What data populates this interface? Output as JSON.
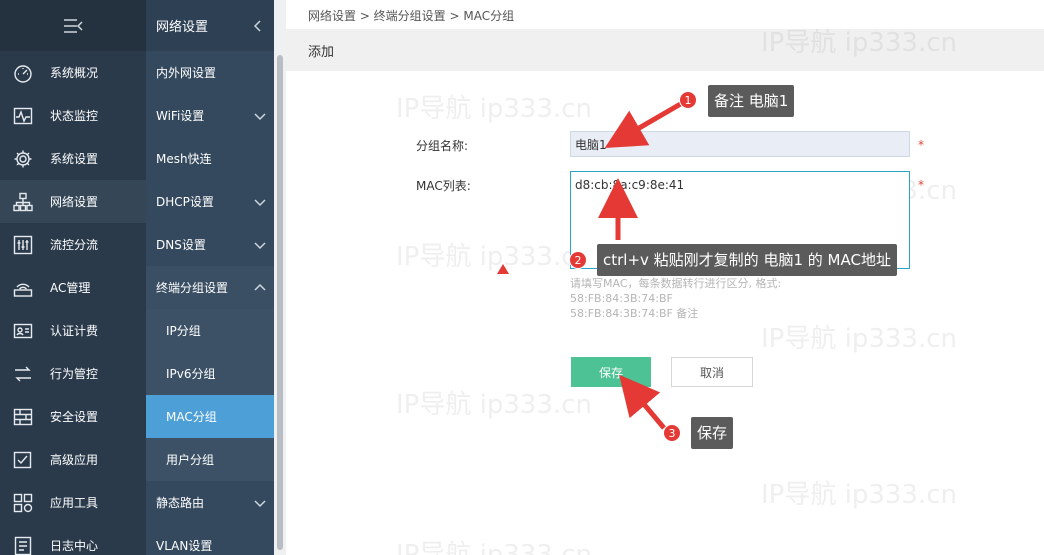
{
  "sidebar": {
    "items": [
      {
        "label": "系统概况",
        "icon": "dashboard-icon"
      },
      {
        "label": "状态监控",
        "icon": "monitor-icon"
      },
      {
        "label": "系统设置",
        "icon": "gear-icon"
      },
      {
        "label": "网络设置",
        "icon": "network-icon"
      },
      {
        "label": "流控分流",
        "icon": "sliders-icon"
      },
      {
        "label": "AC管理",
        "icon": "wifi-ap-icon"
      },
      {
        "label": "认证计费",
        "icon": "id-card-icon"
      },
      {
        "label": "行为管控",
        "icon": "arrows-icon"
      },
      {
        "label": "安全设置",
        "icon": "firewall-icon"
      },
      {
        "label": "高级应用",
        "icon": "checkbox-icon"
      },
      {
        "label": "应用工具",
        "icon": "apps-icon"
      },
      {
        "label": "日志中心",
        "icon": "log-icon"
      }
    ]
  },
  "subbar": {
    "title": "网络设置",
    "items": [
      {
        "label": "内外网设置"
      },
      {
        "label": "WiFi设置"
      },
      {
        "label": "Mesh快连"
      },
      {
        "label": "DHCP设置"
      },
      {
        "label": "DNS设置"
      },
      {
        "label": "终端分组设置"
      },
      {
        "label": "IP分组"
      },
      {
        "label": "IPv6分组"
      },
      {
        "label": "MAC分组"
      },
      {
        "label": "用户分组"
      },
      {
        "label": "静态路由"
      },
      {
        "label": "VLAN设置"
      }
    ]
  },
  "main": {
    "breadcrumb": "网络设置 > 终端分组设置 > MAC分组",
    "page_title": "添加",
    "form": {
      "name_label": "分组名称:",
      "name_value": "电脑1",
      "mac_label": "MAC列表:",
      "mac_value": "d8:cb:8a:c9:8e:41",
      "required_mark": "*",
      "hint_lines": [
        "请填写MAC，每条数据转行进行区分, 格式:",
        "58:FB:84:3B:74:BF",
        "58:FB:84:3B:74:BF 备注"
      ],
      "save_label": "保存",
      "cancel_label": "取消"
    }
  },
  "annotations": {
    "step1_num": "1",
    "step1_text": "备注 电脑1",
    "step2_num": "2",
    "step2_text": "ctrl+v 粘贴刚才复制的 电脑1 的 MAC地址",
    "step3_num": "3",
    "step3_text": "保存",
    "color": "#e53935"
  },
  "watermark": "IP导航  ip333.cn"
}
